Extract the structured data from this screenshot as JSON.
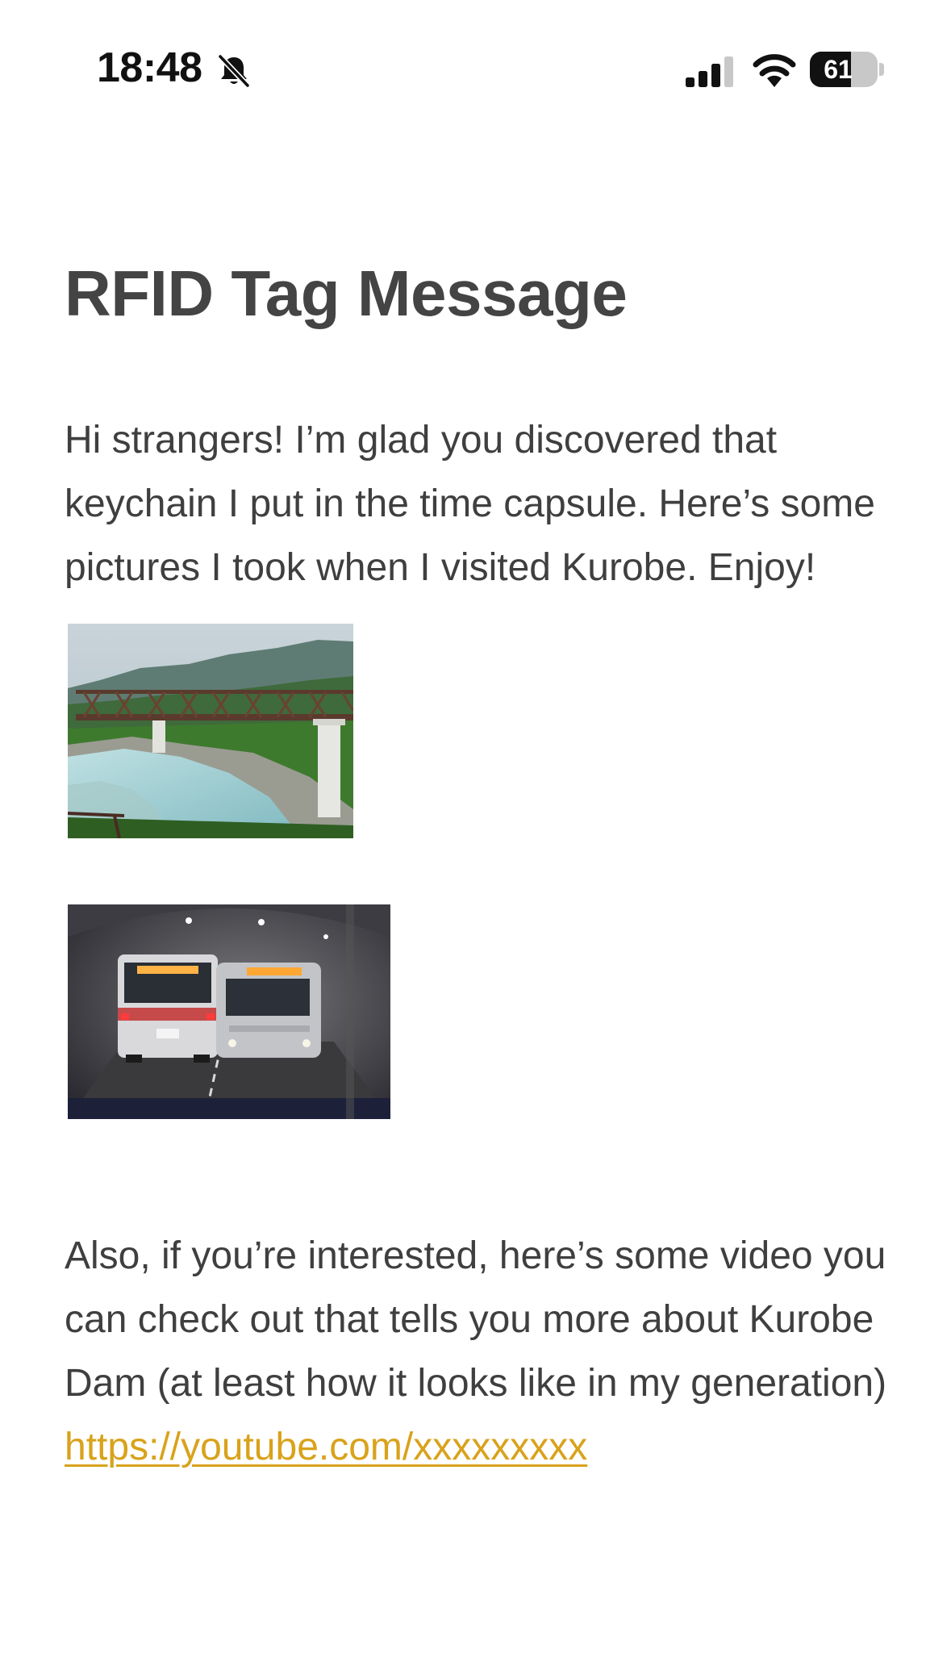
{
  "status_bar": {
    "time": "18:48",
    "battery_level": "61",
    "battery_fraction": 0.61,
    "signal_bars_active": 3,
    "signal_bars_total": 4
  },
  "page": {
    "title": "RFID Tag Message",
    "intro_text": "Hi strangers! I’m glad you discovered that keychain I put in the time capsule. Here’s some pictures I took when I visited Kurobe. Enjoy!",
    "outro_text": "Also, if you’re interested, here’s some video you can check out that tells you more about Kurobe Dam (at least how it looks like in my generation)",
    "video_link": "https://youtube.com/xxxxxxxxx"
  },
  "colors": {
    "text": "#3f3f3f",
    "title": "#444444",
    "link": "#d9a21b",
    "background": "#ffffff"
  },
  "icons": {
    "bell": "bell-slash-icon",
    "signal": "cellular-signal-icon",
    "wifi": "wifi-icon",
    "battery": "battery-icon"
  }
}
